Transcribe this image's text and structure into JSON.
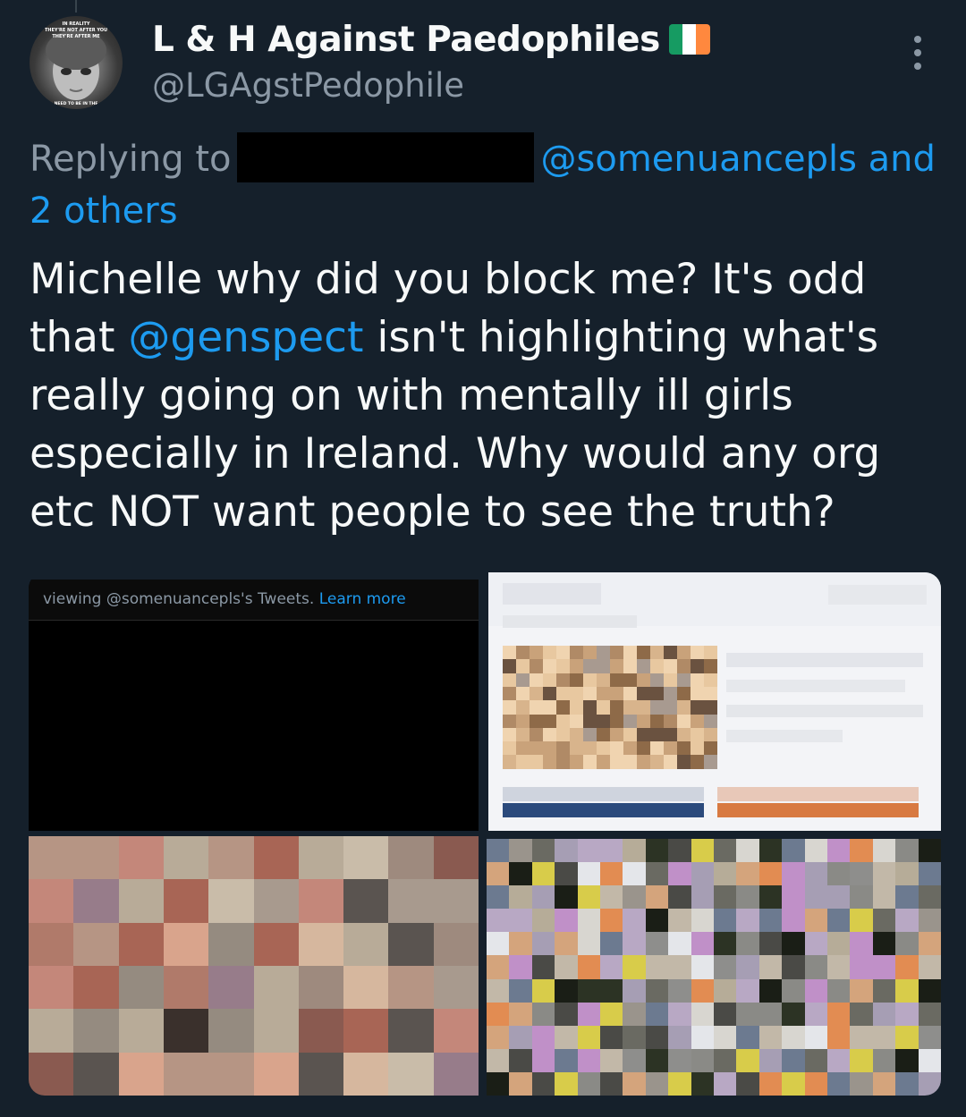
{
  "author": {
    "display_name": "L & H Against Paedophiles",
    "handle": "@LGAgstPedophile",
    "flag_icon": "ireland-flag-icon",
    "avatar_text": [
      "IN REALITY",
      "THEY'RE NOT AFTER YOU",
      "THEY'RE AFTER ME",
      "NEED TO BE IN THE"
    ]
  },
  "reply": {
    "prefix": "Replying to",
    "mention": "@somenuancepls",
    "connector": " and",
    "others": "2 others"
  },
  "tweet": {
    "text_1": "Michelle why did you block me?  It's odd that ",
    "mention": "@genspect",
    "text_2": " isn't highlighting what's really going on with mentally ill girls especially in Ireland. Why would any org etc NOT want people to see the truth?"
  },
  "media": {
    "banner_text": "viewing @somenuancepls's Tweets.",
    "banner_link": "Learn more"
  },
  "colors": {
    "background": "#15202b",
    "accent": "#1d9bf0",
    "secondary_text": "#8b98a5"
  }
}
